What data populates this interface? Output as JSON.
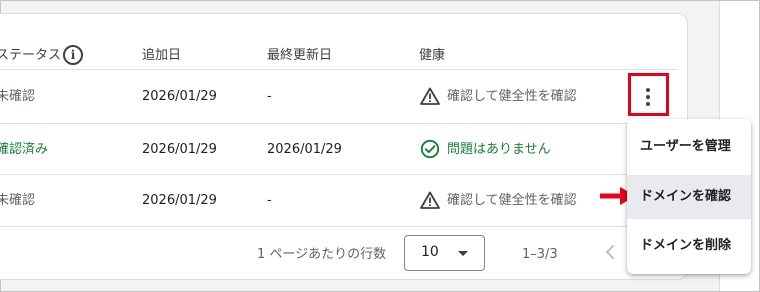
{
  "table": {
    "headers": {
      "status": "ステータス",
      "added": "追加日",
      "updated": "最終更新日",
      "health": "健康"
    },
    "rows": [
      {
        "status": "未確認",
        "added": "2026/01/29",
        "updated": "-",
        "health": "確認して健全性を確認",
        "health_icon": "warning-icon"
      },
      {
        "status": "確認済み",
        "added": "2026/01/29",
        "updated": "2026/01/29",
        "health": "問題はありません",
        "health_icon": "check-circle-icon"
      },
      {
        "status": "未確認",
        "added": "2026/01/29",
        "updated": "-",
        "health": "確認して健全性を確認",
        "health_icon": "warning-icon"
      }
    ]
  },
  "pagination": {
    "rows_per_page_label": "1 ページあたりの行数",
    "rows_per_page_value": "10",
    "range": "1–3/3"
  },
  "menu": {
    "items": [
      "ユーザーを管理",
      "ドメインを確認",
      "ドメインを削除"
    ],
    "highlighted_index": 1
  },
  "colors": {
    "accent_highlight": "#e8001b",
    "verified_green": "#188038"
  }
}
